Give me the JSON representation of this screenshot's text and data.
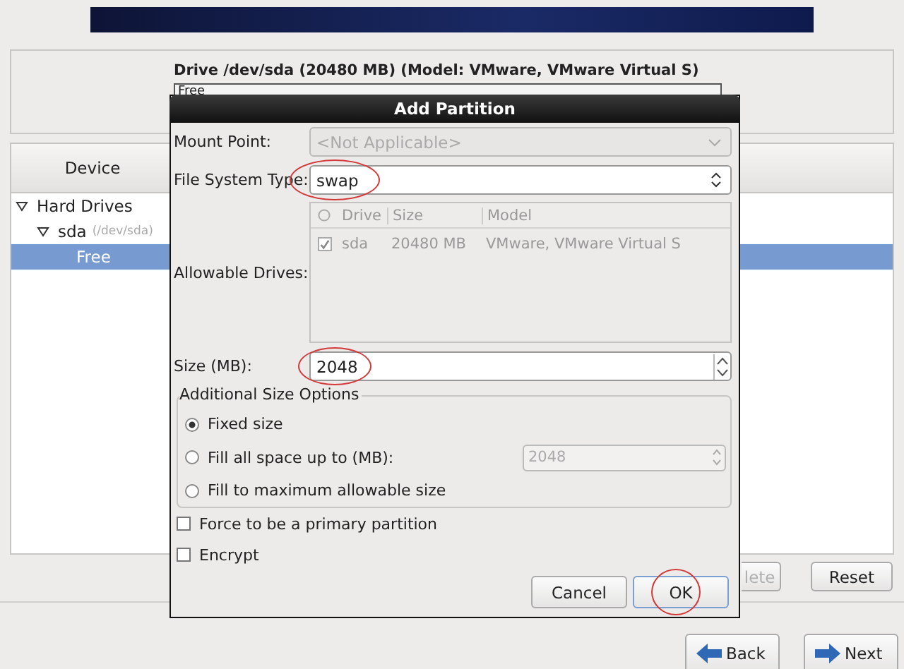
{
  "drive": {
    "title": "Drive /dev/sda (20480 MB) (Model: VMware, VMware Virtual S)",
    "bar_label": "Free"
  },
  "device_table": {
    "columns": [
      "Device"
    ],
    "tree": [
      {
        "label": "Hard Drives",
        "expanded": true,
        "children": [
          {
            "label": "sda",
            "detail": "(/dev/sda)",
            "expanded": true,
            "children": [
              {
                "label": "Free",
                "selected": true
              }
            ]
          }
        ]
      }
    ]
  },
  "action_buttons": [
    {
      "label": "lete",
      "disabled": true
    },
    {
      "label": "Reset",
      "disabled": false
    }
  ],
  "nav_buttons": [
    {
      "label": "Back",
      "kind": "back"
    },
    {
      "label": "Next",
      "kind": "next"
    }
  ],
  "dialog": {
    "title": "Add Partition",
    "mount_point": {
      "label": "Mount Point:",
      "value": "<Not Applicable>",
      "disabled": true
    },
    "file_system_type": {
      "label": "File System Type:",
      "value": "swap",
      "circled": true
    },
    "allowable_drives": {
      "label": "Allowable Drives:",
      "columns": [
        "Drive",
        "Size",
        "Model"
      ],
      "rows": [
        {
          "checked": true,
          "cells": [
            "sda",
            "20480 MB",
            "VMware, VMware Virtual S"
          ]
        }
      ]
    },
    "size": {
      "label": "Size (MB):",
      "value": "2048",
      "circled": true
    },
    "size_options": {
      "title": "Additional Size Options",
      "options": [
        {
          "label": "Fixed size",
          "selected": true
        },
        {
          "label": "Fill all space up to (MB):",
          "selected": false,
          "value": "2048",
          "value_disabled": true
        },
        {
          "label": "Fill to maximum allowable size",
          "selected": false
        }
      ]
    },
    "checkboxes": [
      {
        "label": "Force to be a primary partition",
        "checked": false
      },
      {
        "label": "Encrypt",
        "checked": false
      }
    ],
    "buttons": [
      {
        "label": "Cancel",
        "circled": false
      },
      {
        "label": "OK",
        "circled": true
      }
    ]
  }
}
